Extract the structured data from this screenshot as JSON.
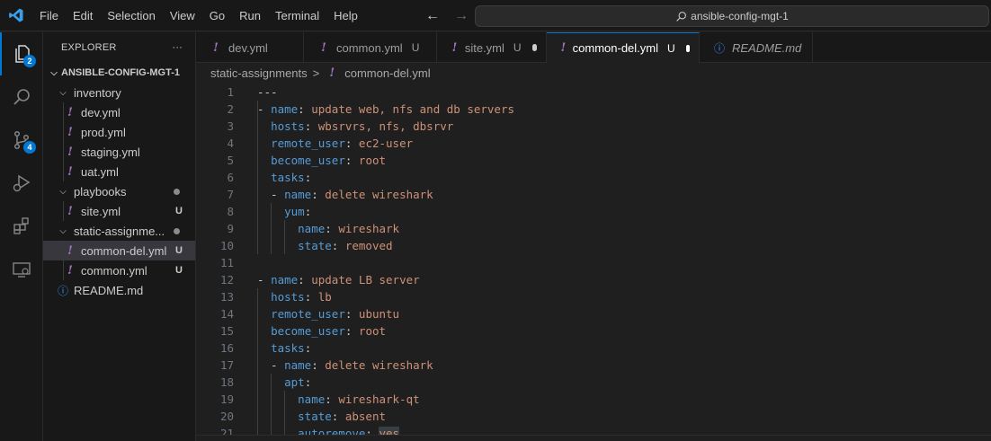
{
  "titlebar": {
    "menu": [
      "File",
      "Edit",
      "Selection",
      "View",
      "Go",
      "Run",
      "Terminal",
      "Help"
    ],
    "search_text": "ansible-config-mgt-1"
  },
  "activity": {
    "explorer_badge": "2",
    "scm_badge": "4"
  },
  "explorer": {
    "title": "EXPLORER",
    "more": "···",
    "root": "ANSIBLE-CONFIG-MGT-1",
    "items": [
      {
        "label": "inventory",
        "type": "folder",
        "status": ""
      },
      {
        "label": "dev.yml",
        "type": "yml",
        "status": ""
      },
      {
        "label": "prod.yml",
        "type": "yml",
        "status": ""
      },
      {
        "label": "staging.yml",
        "type": "yml",
        "status": ""
      },
      {
        "label": "uat.yml",
        "type": "yml",
        "status": ""
      },
      {
        "label": "playbooks",
        "type": "folder",
        "status": "dot"
      },
      {
        "label": "site.yml",
        "type": "yml",
        "status": "U"
      },
      {
        "label": "static-assignme...",
        "type": "folder",
        "status": "dot"
      },
      {
        "label": "common-del.yml",
        "type": "yml",
        "status": "U"
      },
      {
        "label": "common.yml",
        "type": "yml",
        "status": "U"
      },
      {
        "label": "README.md",
        "type": "info",
        "status": ""
      }
    ]
  },
  "tabs": [
    {
      "label": "dev.yml",
      "u": "",
      "dot": false
    },
    {
      "label": "common.yml",
      "u": "U",
      "dot": false
    },
    {
      "label": "site.yml",
      "u": "U",
      "dot": true
    },
    {
      "label": "common-del.yml",
      "u": "U",
      "dot": true
    },
    {
      "label": "README.md",
      "u": "",
      "dot": false
    }
  ],
  "breadcrumb": {
    "folder": "static-assignments",
    "separator": ">",
    "file": "common-del.yml"
  },
  "editor": {
    "lines": [
      {
        "n": "1",
        "indent": "",
        "dash": "",
        "key": "",
        "val": "---",
        "plain": true
      },
      {
        "n": "2",
        "indent": "",
        "dash": "- ",
        "key": "name",
        "val": "update web, nfs and db servers"
      },
      {
        "n": "3",
        "indent": "  ",
        "dash": "",
        "key": "hosts",
        "val": "wbsrvrs, nfs, dbsrvr"
      },
      {
        "n": "4",
        "indent": "  ",
        "dash": "",
        "key": "remote_user",
        "val": "ec2-user"
      },
      {
        "n": "5",
        "indent": "  ",
        "dash": "",
        "key": "become_user",
        "val": "root"
      },
      {
        "n": "6",
        "indent": "  ",
        "dash": "",
        "key": "tasks",
        "val": ""
      },
      {
        "n": "7",
        "indent": "  ",
        "dash": "- ",
        "key": "name",
        "val": "delete wireshark"
      },
      {
        "n": "8",
        "indent": "    ",
        "dash": "",
        "key": "yum",
        "val": ""
      },
      {
        "n": "9",
        "indent": "      ",
        "dash": "",
        "key": "name",
        "val": "wireshark"
      },
      {
        "n": "10",
        "indent": "      ",
        "dash": "",
        "key": "state",
        "val": "removed"
      },
      {
        "n": "11",
        "indent": "",
        "dash": "",
        "key": "",
        "val": "",
        "plain": true
      },
      {
        "n": "12",
        "indent": "",
        "dash": "- ",
        "key": "name",
        "val": "update LB server"
      },
      {
        "n": "13",
        "indent": "  ",
        "dash": "",
        "key": "hosts",
        "val": "lb"
      },
      {
        "n": "14",
        "indent": "  ",
        "dash": "",
        "key": "remote_user",
        "val": "ubuntu"
      },
      {
        "n": "15",
        "indent": "  ",
        "dash": "",
        "key": "become_user",
        "val": "root"
      },
      {
        "n": "16",
        "indent": "  ",
        "dash": "",
        "key": "tasks",
        "val": ""
      },
      {
        "n": "17",
        "indent": "  ",
        "dash": "- ",
        "key": "name",
        "val": "delete wireshark"
      },
      {
        "n": "18",
        "indent": "    ",
        "dash": "",
        "key": "apt",
        "val": ""
      },
      {
        "n": "19",
        "indent": "      ",
        "dash": "",
        "key": "name",
        "val": "wireshark-qt"
      },
      {
        "n": "20",
        "indent": "      ",
        "dash": "",
        "key": "state",
        "val": "absent"
      },
      {
        "n": "21",
        "indent": "      ",
        "dash": "",
        "key": "autoremove",
        "val": "yes"
      }
    ]
  }
}
